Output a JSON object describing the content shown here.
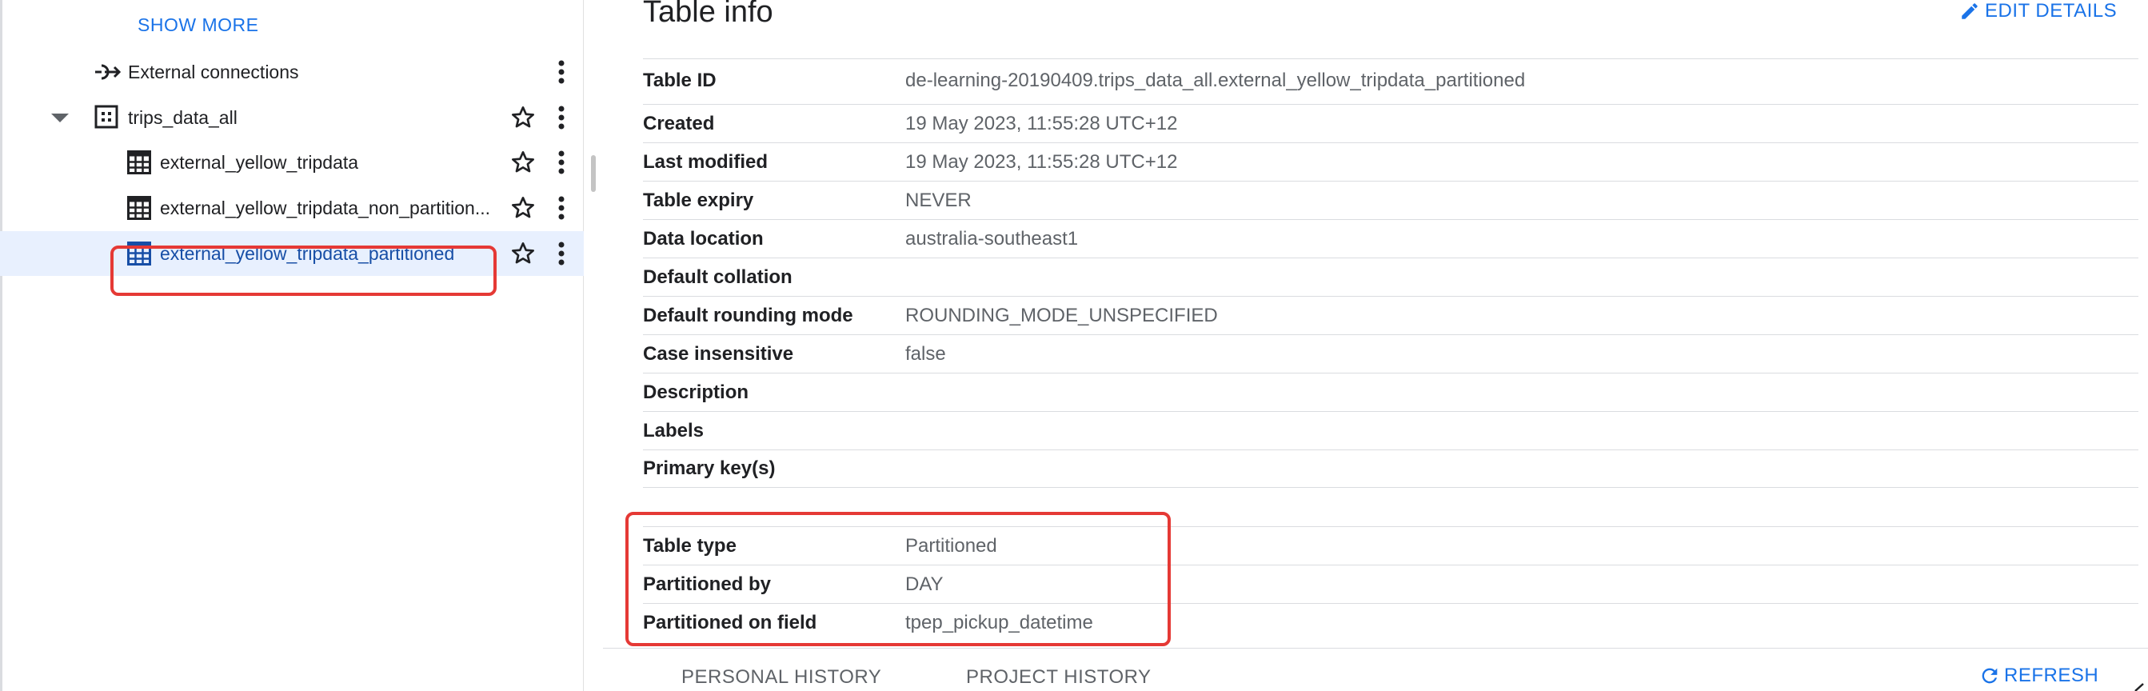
{
  "sidebar": {
    "show_more": "SHOW MORE",
    "items": [
      {
        "label": "External connections"
      },
      {
        "label": "trips_data_all"
      },
      {
        "label": "external_yellow_tripdata"
      },
      {
        "label": "external_yellow_tripdata_non_partition..."
      },
      {
        "label": "external_yellow_tripdata_partitioned"
      }
    ]
  },
  "main": {
    "title": "Table info",
    "edit_details": "EDIT DETAILS",
    "rows": [
      {
        "key": "Table ID",
        "value": "de-learning-20190409.trips_data_all.external_yellow_tripdata_partitioned"
      },
      {
        "key": "Created",
        "value": "19 May 2023, 11:55:28 UTC+12"
      },
      {
        "key": "Last modified",
        "value": "19 May 2023, 11:55:28 UTC+12"
      },
      {
        "key": "Table expiry",
        "value": "NEVER"
      },
      {
        "key": "Data location",
        "value": "australia-southeast1"
      },
      {
        "key": "Default collation",
        "value": ""
      },
      {
        "key": "Default rounding mode",
        "value": "ROUNDING_MODE_UNSPECIFIED"
      },
      {
        "key": "Case insensitive",
        "value": "false"
      },
      {
        "key": "Description",
        "value": ""
      },
      {
        "key": "Labels",
        "value": ""
      },
      {
        "key": "Primary key(s)",
        "value": ""
      },
      {
        "key": "Table type",
        "value": "Partitioned"
      },
      {
        "key": "Partitioned by",
        "value": "DAY"
      },
      {
        "key": "Partitioned on field",
        "value": "tpep_pickup_datetime"
      }
    ]
  },
  "bottom": {
    "personal_history": "PERSONAL HISTORY",
    "project_history": "PROJECT HISTORY",
    "refresh": "REFRESH"
  },
  "colors": {
    "accent": "#1a73e8",
    "selected_bg": "#e8f0fe",
    "highlight": "#e53935"
  }
}
